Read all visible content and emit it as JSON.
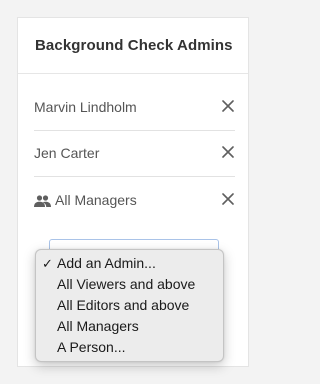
{
  "card": {
    "title": "Background Check Admins"
  },
  "admins": [
    {
      "label": "Marvin Lindholm",
      "icon": null,
      "remove_icon": "close-icon"
    },
    {
      "label": "Jen Carter",
      "icon": null,
      "remove_icon": "close-icon"
    },
    {
      "label": "All Managers",
      "icon": "group-icon",
      "remove_icon": "close-icon"
    }
  ],
  "add_admin_select": {
    "selected": "Add an Admin...",
    "check_mark": "✓",
    "options": [
      "Add an Admin...",
      "All Viewers and above",
      "All Editors and above",
      "All Managers",
      "A Person..."
    ]
  },
  "colors": {
    "page_background": "#f3f3f3",
    "card_background": "#ffffff",
    "title_text": "#333333",
    "row_text": "#555555",
    "menu_background": "#ececec",
    "select_border": "#a9c3e8"
  }
}
